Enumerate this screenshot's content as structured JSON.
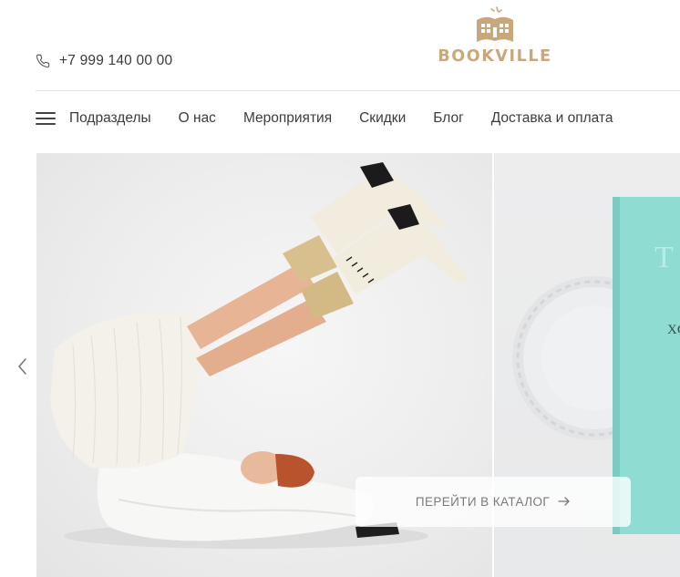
{
  "header": {
    "phone": "+7 999 140 00 00",
    "logo_text": "BOOKVILLE",
    "phone_icon": "phone-icon",
    "logo_icon": "open-book-house-icon"
  },
  "nav": {
    "menu_icon": "hamburger-icon",
    "items": [
      {
        "label": "Подразделы"
      },
      {
        "label": "О нас"
      },
      {
        "label": "Мероприятия"
      },
      {
        "label": "Скидки"
      },
      {
        "label": "Блог"
      },
      {
        "label": "Доставка и оплата"
      }
    ]
  },
  "hero": {
    "prev_icon": "chevron-left-icon",
    "catalog_button": "ПЕРЕЙТИ В КАТАЛОГ",
    "catalog_arrow_icon": "arrow-right-icon",
    "next_slide_book_letters": [
      "T",
      "XC"
    ]
  },
  "colors": {
    "brand": "#c9a77b",
    "text": "#3c3c3c",
    "book_teal": "#8fdcd3"
  }
}
